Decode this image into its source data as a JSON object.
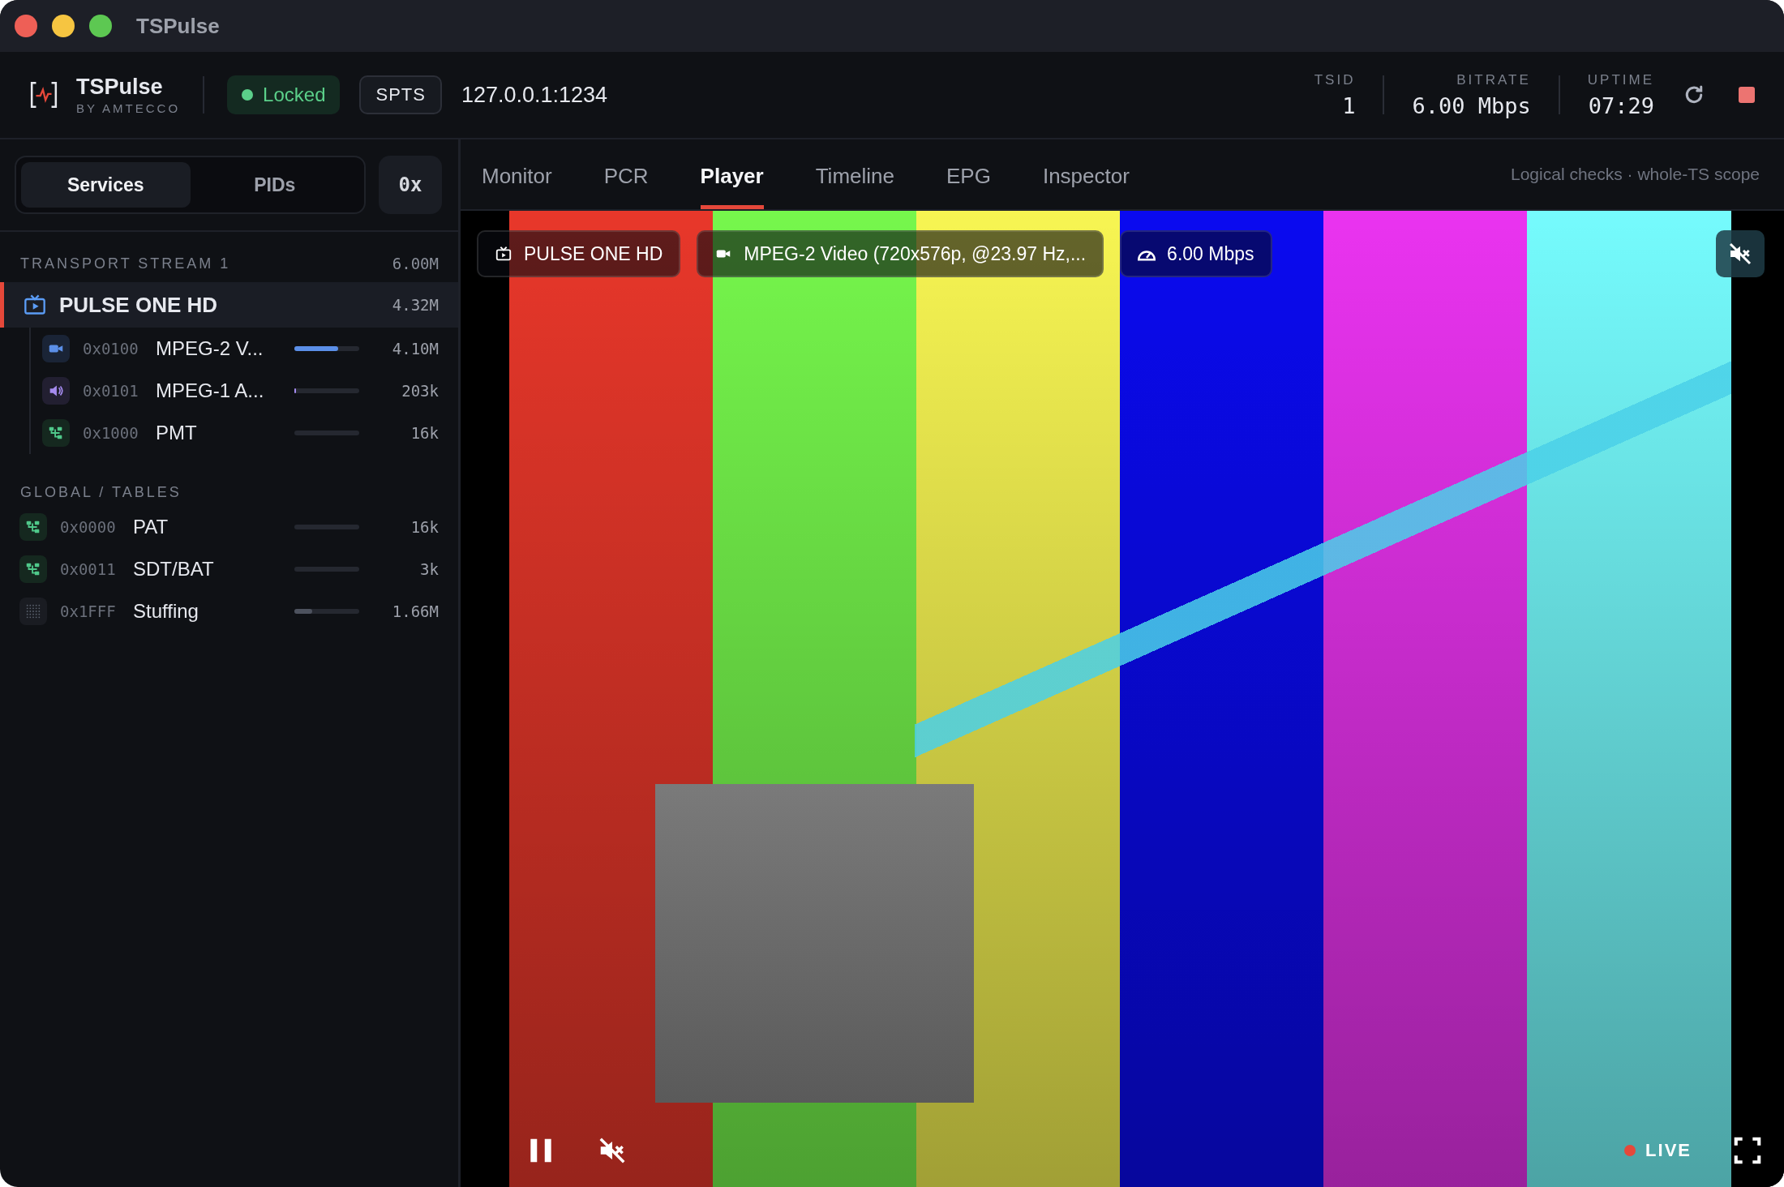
{
  "window": {
    "title": "TSPulse"
  },
  "header": {
    "brand": "TSPulse",
    "byline": "BY AMTECCO",
    "lock_status": "Locked",
    "mode": "SPTS",
    "address": "127.0.0.1:1234",
    "stats": [
      {
        "label": "TSID",
        "value": "1"
      },
      {
        "label": "BITRATE",
        "value": "6.00 Mbps"
      },
      {
        "label": "UPTIME",
        "value": "07:29"
      }
    ]
  },
  "sidebar": {
    "view_tabs": [
      {
        "label": "Services",
        "selected": true
      },
      {
        "label": "PIDs",
        "selected": false
      }
    ],
    "hex_toggle": "0x",
    "sections": [
      {
        "title": "TRANSPORT STREAM 1",
        "rate": "6.00M",
        "items": [
          {
            "kind": "service",
            "name": "PULSE ONE HD",
            "rate": "4.32M",
            "selected": true,
            "children": [
              {
                "kind": "video",
                "pid": "0x0100",
                "name": "MPEG-2 V...",
                "level": 0.68,
                "rate": "4.10M"
              },
              {
                "kind": "audio",
                "pid": "0x0101",
                "name": "MPEG-1 A...",
                "level": 0.03,
                "rate": "203k"
              },
              {
                "kind": "table",
                "pid": "0x1000",
                "name": "PMT",
                "level": 0,
                "rate": "16k"
              }
            ]
          }
        ]
      },
      {
        "title": "GLOBAL / TABLES",
        "items": [
          {
            "kind": "table",
            "pid": "0x0000",
            "name": "PAT",
            "level": 0,
            "rate": "16k"
          },
          {
            "kind": "table",
            "pid": "0x0011",
            "name": "SDT/BAT",
            "level": 0,
            "rate": "3k"
          },
          {
            "kind": "stuffing",
            "pid": "0x1FFF",
            "name": "Stuffing",
            "level": 0.27,
            "rate": "1.66M"
          }
        ]
      }
    ]
  },
  "tabs": [
    {
      "label": "Monitor",
      "selected": false
    },
    {
      "label": "PCR",
      "selected": false
    },
    {
      "label": "Player",
      "selected": true
    },
    {
      "label": "Timeline",
      "selected": false
    },
    {
      "label": "EPG",
      "selected": false
    },
    {
      "label": "Inspector",
      "selected": false
    }
  ],
  "scope_note": "Logical checks · whole-TS scope",
  "player": {
    "overlays": [
      {
        "kind": "service",
        "text": "PULSE ONE HD"
      },
      {
        "kind": "video",
        "text": "MPEG-2 Video (720x576p, @23.97 Hz,..."
      },
      {
        "kind": "bitrate",
        "text": "6.00 Mbps"
      }
    ],
    "muted": true,
    "live": "LIVE"
  }
}
